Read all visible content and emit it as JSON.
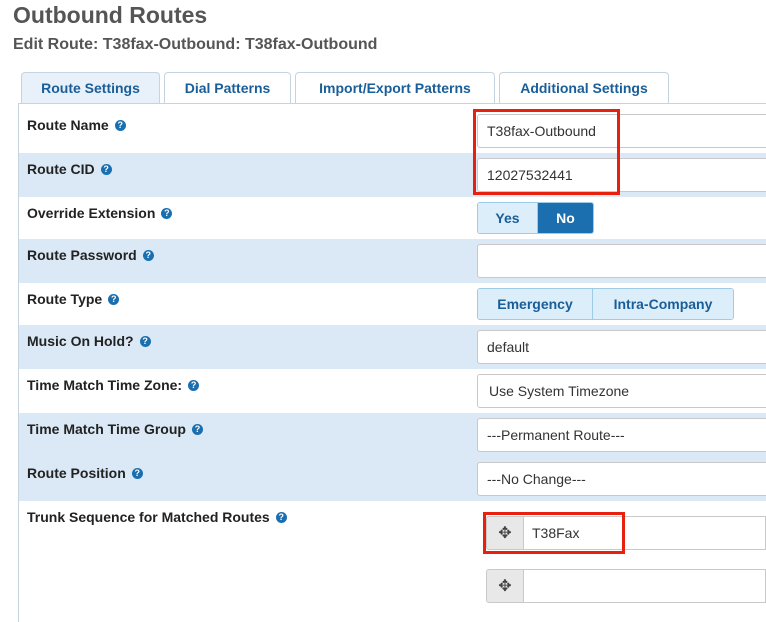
{
  "header": {
    "title": "Outbound Routes",
    "subtitle": "Edit Route: T38fax-Outbound: T38fax-Outbound"
  },
  "tabs": [
    {
      "label": "Route Settings",
      "active": true
    },
    {
      "label": "Dial Patterns",
      "active": false
    },
    {
      "label": "Import/Export Patterns",
      "active": false
    },
    {
      "label": "Additional Settings",
      "active": false
    }
  ],
  "form": {
    "route_name": {
      "label": "Route Name",
      "value": "T38fax-Outbound"
    },
    "route_cid": {
      "label": "Route CID",
      "value": "12027532441"
    },
    "override_extension": {
      "label": "Override Extension",
      "options": [
        "Yes",
        "No"
      ],
      "selected": "No"
    },
    "route_password": {
      "label": "Route Password",
      "value": ""
    },
    "route_type": {
      "label": "Route Type",
      "options": [
        "Emergency",
        "Intra-Company"
      ]
    },
    "music_on_hold": {
      "label": "Music On Hold?",
      "value": "default"
    },
    "time_zone": {
      "label": "Time Match Time Zone:",
      "value": "Use System Timezone"
    },
    "time_group": {
      "label": "Time Match Time Group",
      "value": "---Permanent Route---"
    },
    "route_position": {
      "label": "Route Position",
      "value": "---No Change---"
    },
    "trunk_sequence": {
      "label": "Trunk Sequence for Matched Routes",
      "trunks": [
        "T38Fax",
        ""
      ]
    }
  },
  "icons": {
    "help": "question-circle-icon",
    "drag": "arrows-move-icon"
  },
  "colors": {
    "accent": "#1c6fae",
    "highlight": "#e8210f",
    "row_shade": "#dbe9f6"
  }
}
